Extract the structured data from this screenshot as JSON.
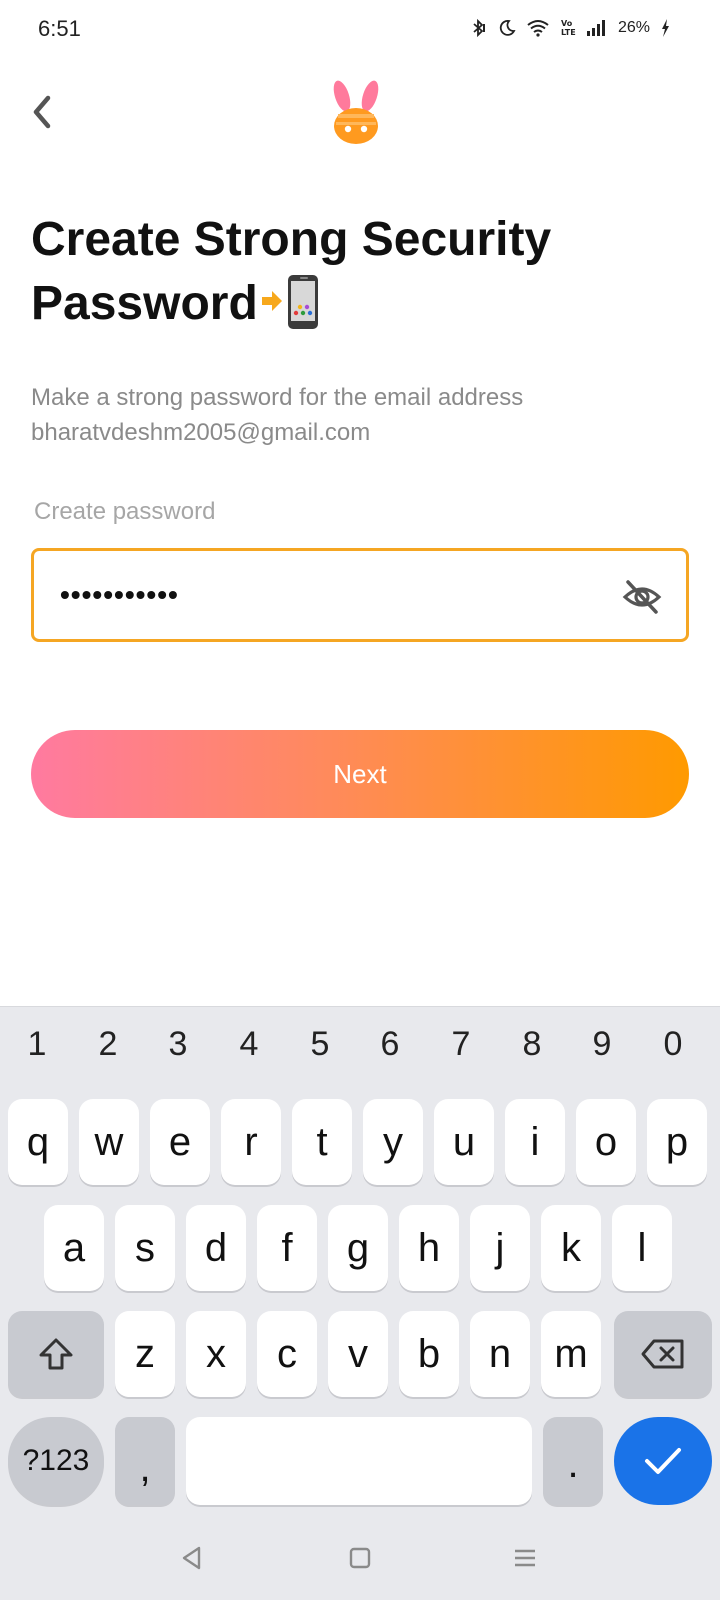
{
  "status_bar": {
    "time": "6:51",
    "battery": "26%",
    "icons": [
      "bluetooth-icon",
      "moon-icon",
      "wifi-icon",
      "volte-icon",
      "signal-icon",
      "charging-icon"
    ]
  },
  "header": {
    "back_icon": "chevron-left-icon",
    "logo_icon": "bunny-logo-icon"
  },
  "title": {
    "line1": "Create Strong Security",
    "line2": "Password",
    "emoji": "phone-arrow-emoji"
  },
  "subtitle": {
    "line1": "Make a strong password for the email address",
    "line2": "bharatvdeshm2005@gmail.com"
  },
  "password_field": {
    "label": "Create password",
    "value": "•••••••••••",
    "toggle_icon": "eye-off-icon"
  },
  "next_button": {
    "label": "Next"
  },
  "keyboard": {
    "numbers": [
      "1",
      "2",
      "3",
      "4",
      "5",
      "6",
      "7",
      "8",
      "9",
      "0"
    ],
    "row1": [
      "q",
      "w",
      "e",
      "r",
      "t",
      "y",
      "u",
      "i",
      "o",
      "p"
    ],
    "row2": [
      "a",
      "s",
      "d",
      "f",
      "g",
      "h",
      "j",
      "k",
      "l"
    ],
    "row3": [
      "z",
      "x",
      "c",
      "v",
      "b",
      "n",
      "m"
    ],
    "symbols_label": "?123",
    "comma": ",",
    "period": ".",
    "shift_icon": "shift-icon",
    "backspace_icon": "backspace-icon",
    "done_icon": "check-icon"
  },
  "nav_bar": {
    "icons": [
      "back-triangle-icon",
      "home-square-icon",
      "recents-menu-icon"
    ]
  },
  "colors": {
    "accent_border": "#f5a623",
    "button_gradient_start": "#ff7aa0",
    "button_gradient_end": "#ff9a00",
    "done_key": "#1a73e8"
  }
}
